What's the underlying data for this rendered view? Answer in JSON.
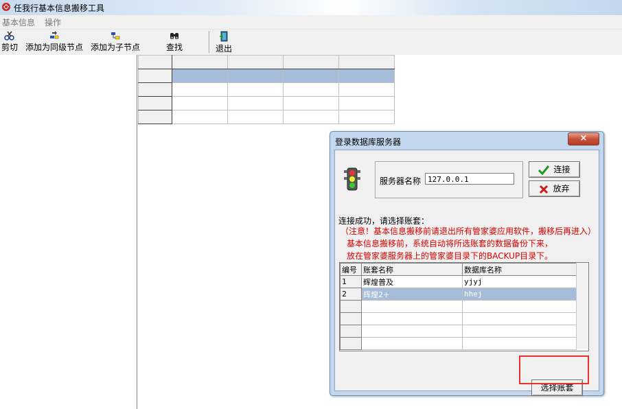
{
  "window": {
    "title": "任我行基本信息搬移工具",
    "icon": "app-icon"
  },
  "menu": [
    {
      "label": "基本信息"
    },
    {
      "label": "操作"
    }
  ],
  "toolbar": [
    {
      "label": "剪切",
      "icon": "cut-icon"
    },
    {
      "label": "添加为同级节点",
      "icon": "add-sibling-node-icon"
    },
    {
      "label": "添加为子节点",
      "icon": "add-child-node-icon"
    },
    {
      "label": "查找",
      "icon": "binoculars-icon"
    },
    {
      "label": "退出",
      "icon": "exit-door-icon"
    }
  ],
  "dialog": {
    "title": "登录数据库服务器",
    "close_label": "×",
    "server_label": "服务器名称",
    "server_value": "127.0.0.1",
    "connect_label": "连接",
    "abandon_label": "放弃",
    "status_message": "连接成功，请选择账套：",
    "warning_1": "（注意！基本信息搬移前请退出所有管家婆应用软件，搬移后再进入）",
    "warning_2": "基本信息搬移前，系统自动将所选账套的数据备份下来，",
    "warning_3": "放在管家婆服务器上的管家婆目录下的BACKUP目录下。",
    "table_headers": {
      "num": "编号",
      "name": "账套名称",
      "db": "数据库名称"
    },
    "accounts": [
      {
        "num": "1",
        "name": "辉煌普及",
        "db": "yjyj"
      },
      {
        "num": "2",
        "name": "辉煌2+",
        "db": "hhej"
      }
    ],
    "select_button": "选择账套"
  },
  "colors": {
    "selection": "#a6bcd8",
    "warning": "#d60000",
    "highlight_box": "#e8322c"
  }
}
